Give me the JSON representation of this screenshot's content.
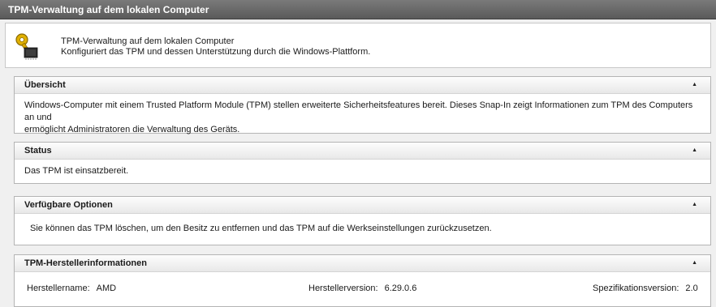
{
  "window": {
    "title": "TPM-Verwaltung auf dem lokalen Computer"
  },
  "header": {
    "icon": "key-chip-icon",
    "line1": "TPM-Verwaltung auf dem lokalen Computer",
    "line2": "Konfiguriert das TPM und dessen Unterstützung durch die Windows-Plattform."
  },
  "overview": {
    "title": "Übersicht",
    "collapse_glyph": "▲",
    "line1": "Windows-Computer mit einem Trusted Platform Module (TPM) stellen erweiterte Sicherheitsfeatures bereit. Dieses Snap-In zeigt Informationen zum TPM des Computers an und",
    "line2": "ermöglicht Administratoren die Verwaltung des Geräts."
  },
  "status": {
    "title": "Status",
    "collapse_glyph": "▲",
    "text": "Das TPM ist einsatzbereit."
  },
  "options": {
    "title": "Verfügbare Optionen",
    "collapse_glyph": "▲",
    "text": "Sie können das TPM löschen, um den Besitz zu entfernen und das TPM auf die Werkseinstellungen zurückzusetzen."
  },
  "manufacturer": {
    "title": "TPM-Herstellerinformationen",
    "collapse_glyph": "▲",
    "name_label": "Herstellername:",
    "name_value": "AMD",
    "version_label": "Herstellerversion:",
    "version_value": "6.29.0.6",
    "spec_label": "Spezifikationsversion:",
    "spec_value": "2.0"
  }
}
